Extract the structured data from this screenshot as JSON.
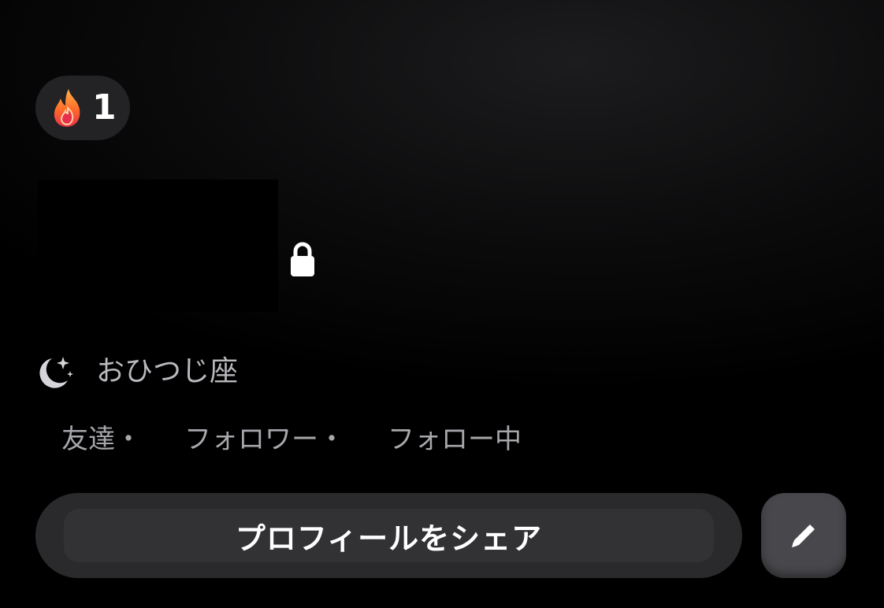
{
  "streak": {
    "count": "1",
    "icon": "flame-icon"
  },
  "profile": {
    "locked_icon": "lock-icon",
    "zodiac_icon": "moon-stars-icon",
    "zodiac": "おひつじ座"
  },
  "stats": {
    "friends": "友達・",
    "followers": "フォロワー・",
    "following": "フォロー中"
  },
  "actions": {
    "share_label": "プロフィールをシェア",
    "edit_icon": "pencil-icon"
  },
  "colors": {
    "background": "#000000",
    "pill": "#232325",
    "button": "#2a2a2d",
    "edit_button": "#48484c",
    "text_muted": "#a7a7ac"
  }
}
